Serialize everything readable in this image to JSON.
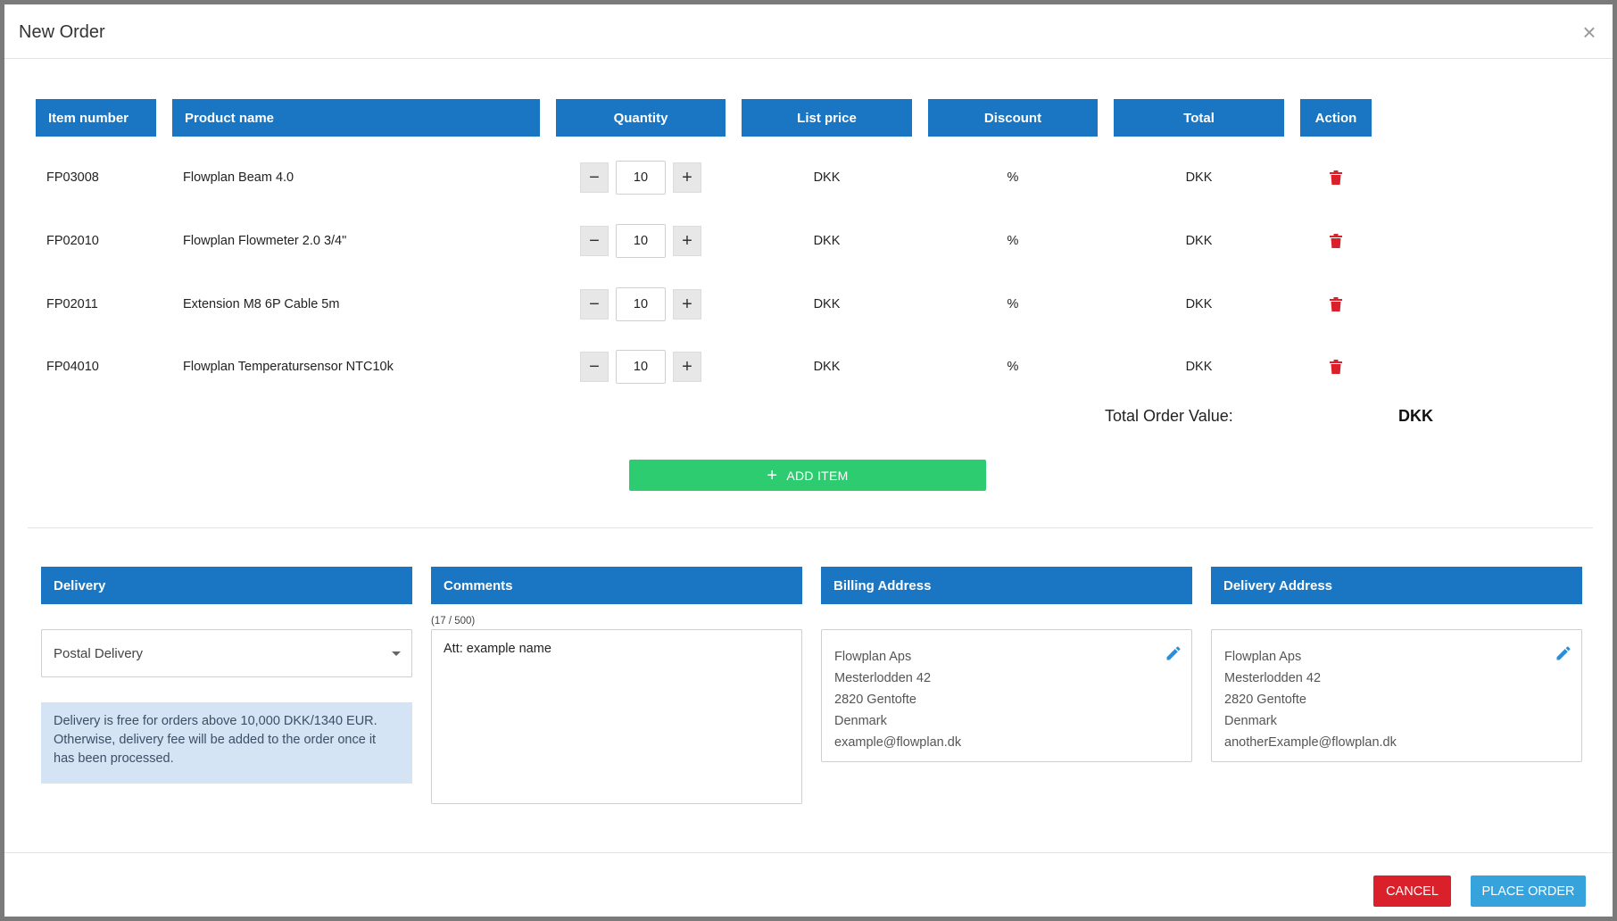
{
  "modal": {
    "title": "New Order",
    "close_glyph": "×"
  },
  "table": {
    "headers": {
      "item_number": "Item number",
      "product_name": "Product name",
      "quantity": "Quantity",
      "list_price": "List price",
      "discount": "Discount",
      "total": "Total",
      "action": "Action"
    },
    "rows": [
      {
        "item_number": "FP03008",
        "product_name": "Flowplan Beam 4.0",
        "quantity": "10",
        "list_price": "DKK",
        "discount": "%",
        "total": "DKK"
      },
      {
        "item_number": "FP02010",
        "product_name": "Flowplan Flowmeter 2.0 3/4\"",
        "quantity": "10",
        "list_price": "DKK",
        "discount": "%",
        "total": "DKK"
      },
      {
        "item_number": "FP02011",
        "product_name": "Extension M8 6P Cable 5m",
        "quantity": "10",
        "list_price": "DKK",
        "discount": "%",
        "total": "DKK"
      },
      {
        "item_number": "FP04010",
        "product_name": "Flowplan Temperatursensor NTC10k",
        "quantity": "10",
        "list_price": "DKK",
        "discount": "%",
        "total": "DKK"
      }
    ],
    "minus_glyph": "−",
    "plus_glyph": "+",
    "action_icon": "trash-icon"
  },
  "summary": {
    "total_label": "Total Order Value:",
    "total_value": "DKK"
  },
  "add_item": {
    "icon": "+",
    "label": "ADD ITEM"
  },
  "delivery": {
    "heading": "Delivery",
    "selected": "Postal Delivery",
    "info": "Delivery is free for orders above 10,000 DKK/1340 EUR. Otherwise, delivery fee will be added to the order once it has been processed."
  },
  "comments": {
    "heading": "Comments",
    "counter": "(17 / 500)",
    "value": "Att: example name"
  },
  "billing_address": {
    "heading": "Billing Address",
    "lines": [
      "Flowplan Aps",
      "Mesterlodden 42",
      "2820 Gentofte",
      "Denmark",
      "example@flowplan.dk"
    ]
  },
  "delivery_address": {
    "heading": "Delivery Address",
    "lines": [
      "Flowplan Aps",
      "Mesterlodden 42",
      "2820 Gentofte",
      "Denmark",
      "anotherExample@flowplan.dk"
    ]
  },
  "footer": {
    "cancel_label": "CANCEL",
    "place_order_label": "PLACE ORDER"
  },
  "colors": {
    "header_blue": "#1a76c2",
    "add_green": "#2ecc71",
    "cancel_red": "#d9202b",
    "place_blue": "#36a3dd",
    "trash_red": "#d9202b",
    "edit_blue": "#2a8fd6"
  }
}
